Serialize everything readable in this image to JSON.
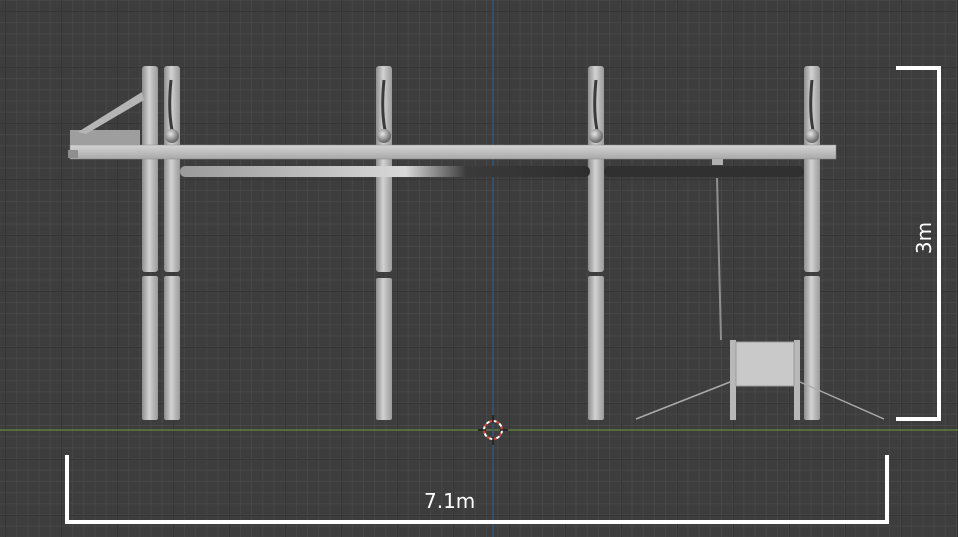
{
  "viewport": {
    "background": "#3d3d3d",
    "grid_minor": "#474747",
    "grid_major": "#353535",
    "axis_x_color": "#6f9a3a",
    "axis_z_color": "#2c5f9a",
    "cursor_icon": "3d-cursor-icon"
  },
  "model": {
    "color": "#bdbdbd",
    "posts": 4
  },
  "dimensions": {
    "width_label": "7.1m",
    "height_label": "3m",
    "bracket_color": "#ffffff"
  }
}
